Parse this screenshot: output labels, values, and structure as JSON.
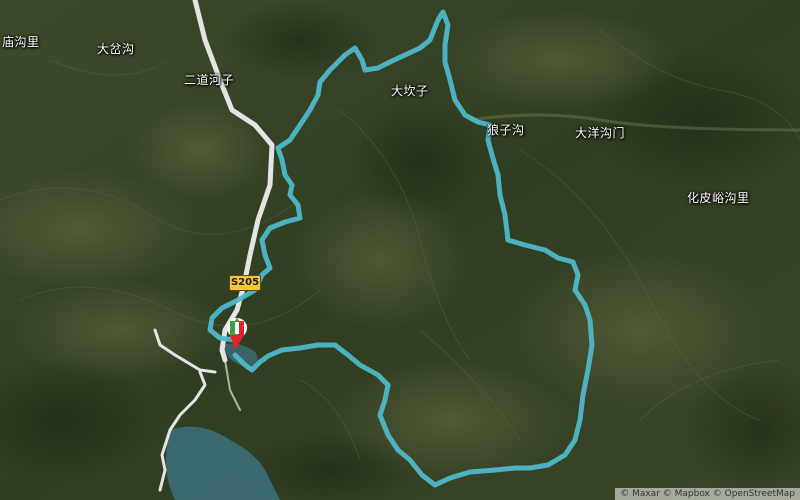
{
  "map": {
    "places": [
      {
        "name": "庙沟里"
      },
      {
        "name": "大岔沟"
      },
      {
        "name": "二道河子"
      },
      {
        "name": "大坎子"
      },
      {
        "name": "狼子沟"
      },
      {
        "name": "大洋沟门"
      },
      {
        "name": "化皮峪沟里"
      }
    ],
    "road_shield": "S205",
    "attribution": "© Maxar © Mapbox © OpenStreetMap",
    "colors": {
      "route": "#4fb8c9",
      "road": "#e4e4e4",
      "water": "#3c6e78",
      "flag_green": "#3aa23c",
      "flag_red": "#e0242a"
    }
  }
}
